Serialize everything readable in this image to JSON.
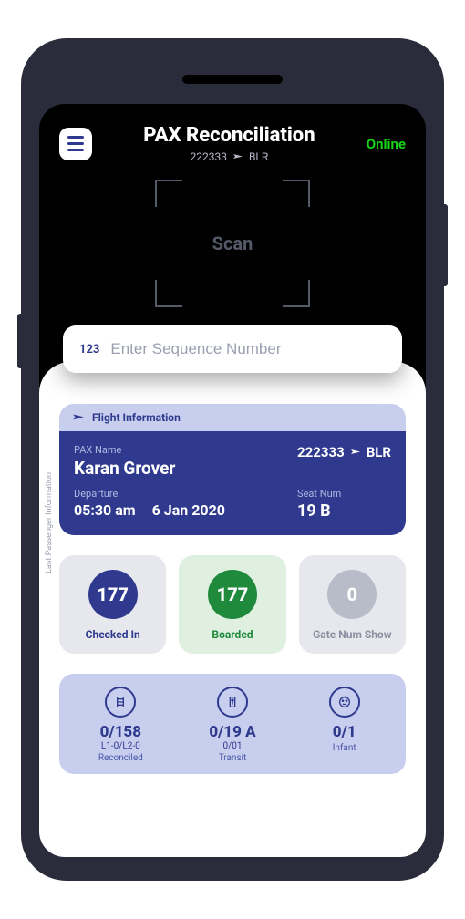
{
  "header": {
    "title": "PAX Reconciliation",
    "flight_code": "222333",
    "airport": "BLR",
    "status": "Online",
    "scan_label": "Scan"
  },
  "search": {
    "prefix": "123",
    "placeholder": "Enter Sequence Number"
  },
  "side_label": "Last Passenger Information",
  "flight_card": {
    "header": "Flight Information",
    "pax_label": "PAX Name",
    "pax_name": "Karan Grover",
    "dep_label": "Departure",
    "dep_time": "05:30 am",
    "dep_date": "6 Jan 2020",
    "id": "222333",
    "airport": "BLR",
    "seat_label": "Seat Num",
    "seat": "19 B"
  },
  "tiles": {
    "checked_in": {
      "value": "177",
      "label": "Checked In"
    },
    "boarded": {
      "value": "177",
      "label": "Boarded"
    },
    "gate": {
      "value": "0",
      "label": "Gate Num Show"
    }
  },
  "details": {
    "reconciled": {
      "main": "0/158",
      "sub": "L1-0/L2-0",
      "label": "Reconciled"
    },
    "transit": {
      "main": "0/19 A",
      "sub": "0/01",
      "label": "Transit"
    },
    "infant": {
      "main": "0/1",
      "sub": "",
      "label": "Infant"
    }
  }
}
